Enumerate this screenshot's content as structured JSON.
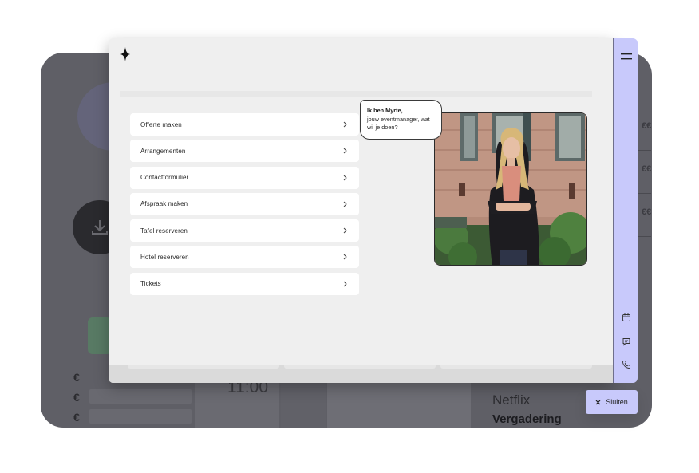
{
  "background": {
    "time": "11:00",
    "euro_symbol": "€",
    "right_labels": [
      "€€",
      "€€",
      "€€"
    ],
    "netflix": "Netflix",
    "meeting": "Vergadering"
  },
  "modal": {
    "logo_icon": "diamond-sparkle-icon",
    "menu": [
      {
        "label": "Offerte maken"
      },
      {
        "label": "Arrangementen"
      },
      {
        "label": "Contactformulier"
      },
      {
        "label": "Afspraak maken"
      },
      {
        "label": "Tafel reserveren"
      },
      {
        "label": "Hotel reserveren"
      },
      {
        "label": "Tickets"
      }
    ],
    "bubble": {
      "greeting": "Ik ben Myrte,",
      "line1": "jouw eventmanager, wat",
      "line2": "wil je doen?"
    }
  },
  "sidebar": {
    "icons": [
      "menu-icon",
      "calendar-icon",
      "chat-icon",
      "phone-icon"
    ],
    "accent_color": "#c8c9fb"
  },
  "close": {
    "label": "Sluiten"
  }
}
